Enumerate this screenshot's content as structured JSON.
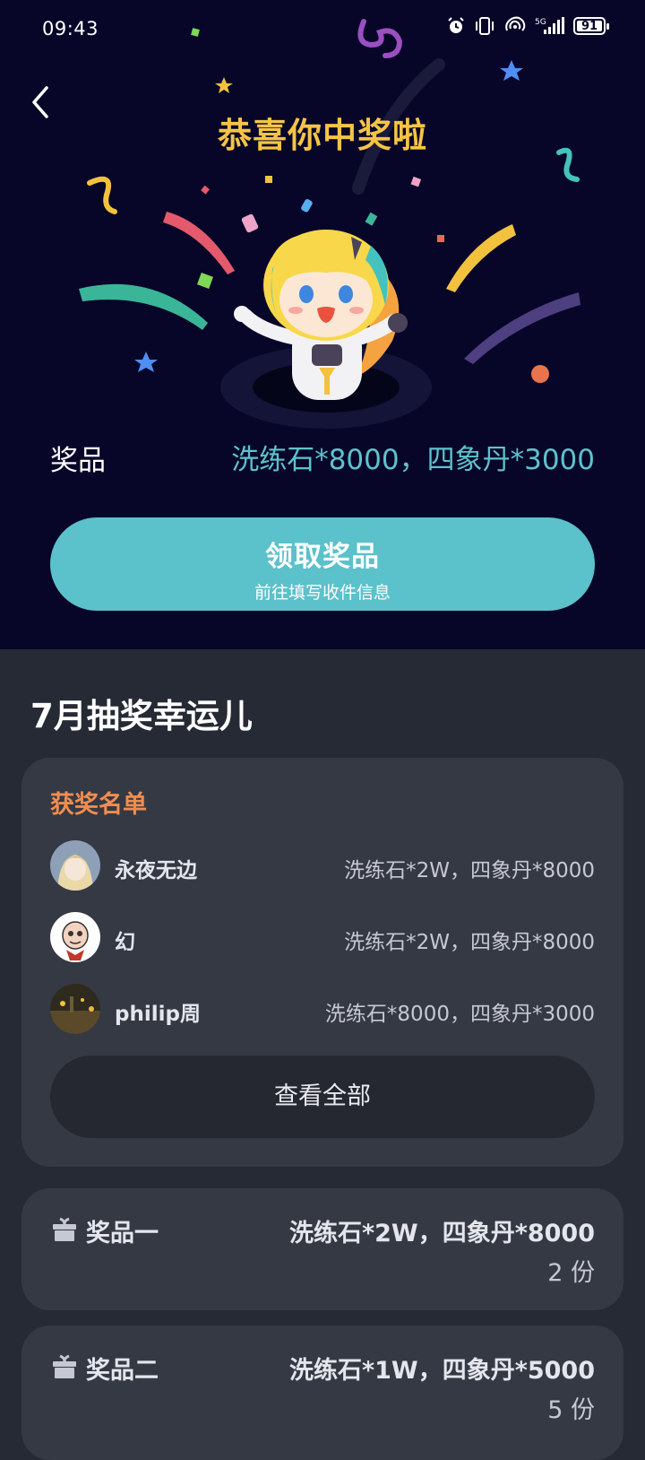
{
  "status_bar": {
    "time": "09:43",
    "battery": "91"
  },
  "hero": {
    "title": "恭喜你中奖啦",
    "prize_label": "奖品",
    "prize_value": "洗练石*8000，四象丹*3000",
    "claim_button": {
      "label": "领取奖品",
      "sublabel": "前往填写收件信息"
    }
  },
  "lucky": {
    "title": "7月抽奖幸运儿",
    "list_title": "获奖名单",
    "winners": [
      {
        "name": "永夜无边",
        "reward": "洗练石*2W，四象丹*8000"
      },
      {
        "name": "幻",
        "reward": "洗练石*2W，四象丹*8000"
      },
      {
        "name": "philip周",
        "reward": "洗练石*8000，四象丹*3000"
      }
    ],
    "view_all": "查看全部"
  },
  "prizes": [
    {
      "name": "奖品一",
      "desc": "洗练石*2W，四象丹*8000",
      "count": "2 份"
    },
    {
      "name": "奖品二",
      "desc": "洗练石*1W，四象丹*5000",
      "count": "5 份"
    }
  ],
  "colors": {
    "hero_bg": "#070628",
    "accent": "#5bc1cb",
    "title": "#f6c445",
    "list_title": "#f08d4e"
  }
}
